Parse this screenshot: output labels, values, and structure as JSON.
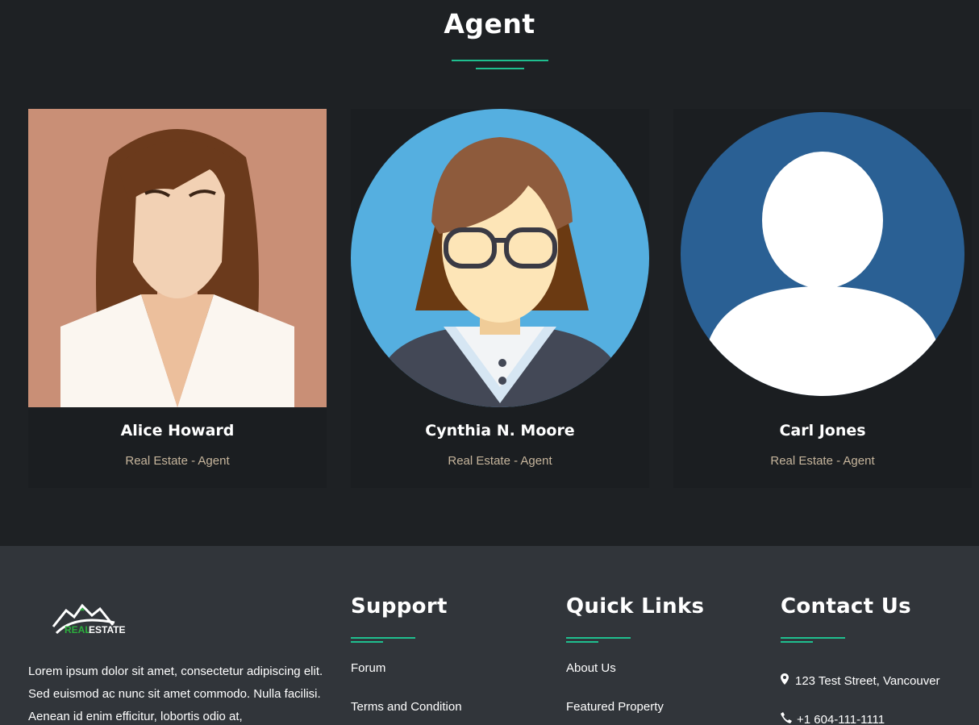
{
  "section": {
    "title": "Agent"
  },
  "agents": [
    {
      "name": "Alice Howard",
      "role": "Real Estate - Agent"
    },
    {
      "name": "Cynthia N. Moore",
      "role": "Real Estate - Agent"
    },
    {
      "name": "Carl Jones",
      "role": "Real Estate - Agent"
    }
  ],
  "footer": {
    "logo": {
      "text_a": "REAL",
      "text_b": "ESTATE"
    },
    "about": "Lorem ipsum dolor sit amet, consectetur adipiscing elit. Sed euismod ac nunc sit amet commodo. Nulla facilisi. Aenean id enim efficitur, lobortis odio at,",
    "support": {
      "heading": "Support",
      "links": [
        "Forum",
        "Terms and Condition"
      ]
    },
    "quick_links": {
      "heading": "Quick Links",
      "links": [
        "About Us",
        "Featured Property"
      ]
    },
    "contact": {
      "heading": "Contact Us",
      "address": "123 Test Street, Vancouver",
      "phone": "+1 604-111-1111",
      "icons": [
        "map-pin-icon",
        "phone-icon"
      ]
    }
  },
  "colors": {
    "accent": "#1fbf8f",
    "bg_dark": "#1e2124",
    "footer_bg": "#31353a",
    "role_text": "#c6b59c"
  }
}
